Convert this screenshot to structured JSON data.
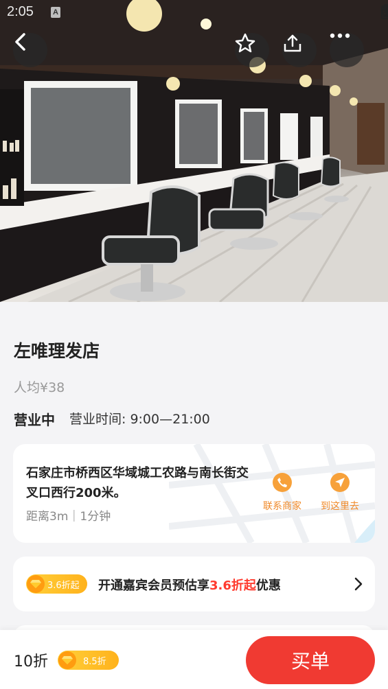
{
  "status_bar": {
    "time": "2:05",
    "notif_glyph": "A"
  },
  "nav": {
    "back_icon": "chevron-left-icon",
    "favorite_icon": "star-icon",
    "share_icon": "share-icon",
    "more_icon": "more-dots-icon"
  },
  "shop": {
    "name": "左唯理发店",
    "avg_price": "人均¥38",
    "status": "营业中",
    "hours": "营业时间: 9:00—21:00"
  },
  "address": {
    "text": "石家庄市桥西区华域城工农路与南长街交叉口西行200米。",
    "distance": "距离3m｜1分钟",
    "contact_label": "联系商家",
    "navigate_label": "到这里去"
  },
  "membership": {
    "badge": "3.6折起",
    "text_prefix": "开通嘉宾会员预估享",
    "text_highlight": "3.6折起",
    "text_suffix": "优惠"
  },
  "bottom": {
    "price": "10折",
    "member_badge": "8.5折",
    "buy_label": "买单"
  },
  "colors": {
    "accent_red": "#f03a32",
    "accent_orange": "#f7a13a",
    "badge_gold": "#ffc12a"
  }
}
